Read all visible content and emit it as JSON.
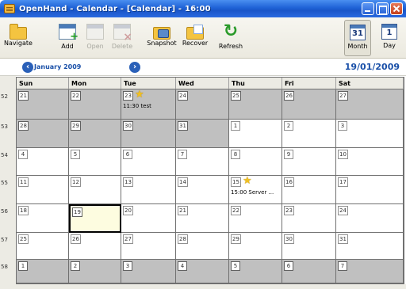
{
  "window": {
    "title": "OpenHand - Calendar - [Calendar] - 16:00"
  },
  "toolbar": {
    "navigate": "Navigate",
    "add": "Add",
    "open": "Open",
    "delete": "Delete",
    "snapshot": "Snapshot",
    "recover": "Recover",
    "refresh": "Refresh",
    "month": "Month",
    "day": "Day",
    "month_icon": "31",
    "day_icon": "1"
  },
  "nav": {
    "month_label": "January 2009",
    "current_date": "19/01/2009"
  },
  "calendar": {
    "days": [
      "Sun",
      "Mon",
      "Tue",
      "Wed",
      "Thu",
      "Fri",
      "Sat"
    ],
    "weeks": [
      {
        "num": "52",
        "days": [
          {
            "d": "21",
            "shade": "grey"
          },
          {
            "d": "22",
            "shade": "grey"
          },
          {
            "d": "23",
            "shade": "grey",
            "star": true,
            "event": "11:30 test"
          },
          {
            "d": "24",
            "shade": "grey"
          },
          {
            "d": "25",
            "shade": "grey"
          },
          {
            "d": "26",
            "shade": "grey"
          },
          {
            "d": "27",
            "shade": "grey"
          }
        ]
      },
      {
        "num": "53",
        "days": [
          {
            "d": "28",
            "shade": "grey"
          },
          {
            "d": "29",
            "shade": "grey"
          },
          {
            "d": "30",
            "shade": "grey"
          },
          {
            "d": "31",
            "shade": "grey"
          },
          {
            "d": "1",
            "shade": "white"
          },
          {
            "d": "2",
            "shade": "white"
          },
          {
            "d": "3",
            "shade": "white"
          }
        ]
      },
      {
        "num": "54",
        "days": [
          {
            "d": "4",
            "shade": "white"
          },
          {
            "d": "5",
            "shade": "white"
          },
          {
            "d": "6",
            "shade": "white"
          },
          {
            "d": "7",
            "shade": "white"
          },
          {
            "d": "8",
            "shade": "white"
          },
          {
            "d": "9",
            "shade": "white"
          },
          {
            "d": "10",
            "shade": "white"
          }
        ]
      },
      {
        "num": "55",
        "days": [
          {
            "d": "11",
            "shade": "white"
          },
          {
            "d": "12",
            "shade": "white"
          },
          {
            "d": "13",
            "shade": "white"
          },
          {
            "d": "14",
            "shade": "white"
          },
          {
            "d": "15",
            "shade": "white",
            "star": true,
            "event": "15:00 Server ..."
          },
          {
            "d": "16",
            "shade": "white"
          },
          {
            "d": "17",
            "shade": "white"
          }
        ]
      },
      {
        "num": "56",
        "days": [
          {
            "d": "18",
            "shade": "white"
          },
          {
            "d": "19",
            "shade": "selected"
          },
          {
            "d": "20",
            "shade": "white"
          },
          {
            "d": "21",
            "shade": "white"
          },
          {
            "d": "22",
            "shade": "white"
          },
          {
            "d": "23",
            "shade": "white"
          },
          {
            "d": "24",
            "shade": "white"
          }
        ]
      },
      {
        "num": "57",
        "days": [
          {
            "d": "25",
            "shade": "white"
          },
          {
            "d": "26",
            "shade": "white"
          },
          {
            "d": "27",
            "shade": "white"
          },
          {
            "d": "28",
            "shade": "white"
          },
          {
            "d": "29",
            "shade": "white"
          },
          {
            "d": "30",
            "shade": "white"
          },
          {
            "d": "31",
            "shade": "white"
          }
        ]
      },
      {
        "num": "58",
        "days": [
          {
            "d": "1",
            "shade": "grey"
          },
          {
            "d": "2",
            "shade": "grey"
          },
          {
            "d": "3",
            "shade": "grey"
          },
          {
            "d": "4",
            "shade": "grey"
          },
          {
            "d": "5",
            "shade": "grey"
          },
          {
            "d": "6",
            "shade": "grey"
          },
          {
            "d": "7",
            "shade": "grey"
          }
        ]
      }
    ]
  }
}
